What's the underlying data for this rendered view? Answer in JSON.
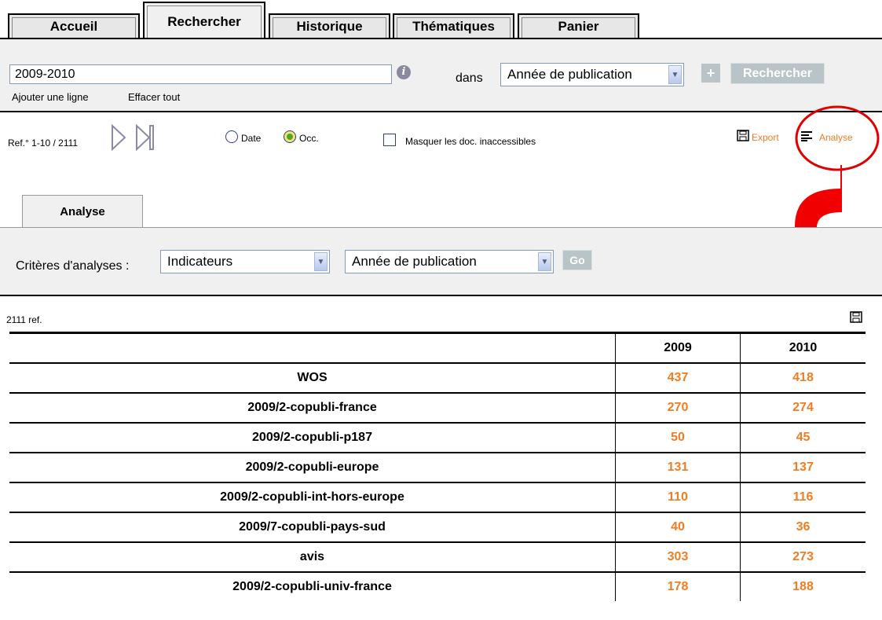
{
  "tabs": [
    {
      "label": "Accueil"
    },
    {
      "label": "Rechercher"
    },
    {
      "label": "Historique"
    },
    {
      "label": "Thématiques"
    },
    {
      "label": "Panier"
    }
  ],
  "search": {
    "query": "2009-2010",
    "dans_label": "dans",
    "field_selected": "Année de publication",
    "plus_label": "+",
    "search_button": "Rechercher",
    "add_line": "Ajouter une ligne",
    "clear_all": "Effacer tout"
  },
  "results": {
    "ref_range": "Ref.° 1-10 / 2111",
    "sort_date": "Date",
    "sort_occ": "Occ.",
    "hide_label": "Masquer les doc. inaccessibles",
    "export": "Export",
    "analyse": "Analyse"
  },
  "analysis": {
    "tab_label": "Analyse",
    "criteria_label": "Critères d'analyses :",
    "criteria1": "Indicateurs",
    "criteria2": "Année de publication",
    "go": "Go",
    "ref_count": "2111 ref."
  },
  "table": {
    "columns": [
      "",
      "2009",
      "2010"
    ],
    "rows": [
      [
        "WOS",
        "437",
        "418"
      ],
      [
        "2009/2-copubli-france",
        "270",
        "274"
      ],
      [
        "2009/2-copubli-p187",
        "50",
        "45"
      ],
      [
        "2009/2-copubli-europe",
        "131",
        "137"
      ],
      [
        "2009/2-copubli-int-hors-europe",
        "110",
        "116"
      ],
      [
        "2009/7-copubli-pays-sud",
        "40",
        "36"
      ],
      [
        "avis",
        "303",
        "273"
      ],
      [
        "2009/2-copubli-univ-france",
        "178",
        "188"
      ]
    ]
  },
  "colors": {
    "accent": "#f07d22",
    "annotation": "#e00000",
    "panel": "#f0f0f0"
  }
}
